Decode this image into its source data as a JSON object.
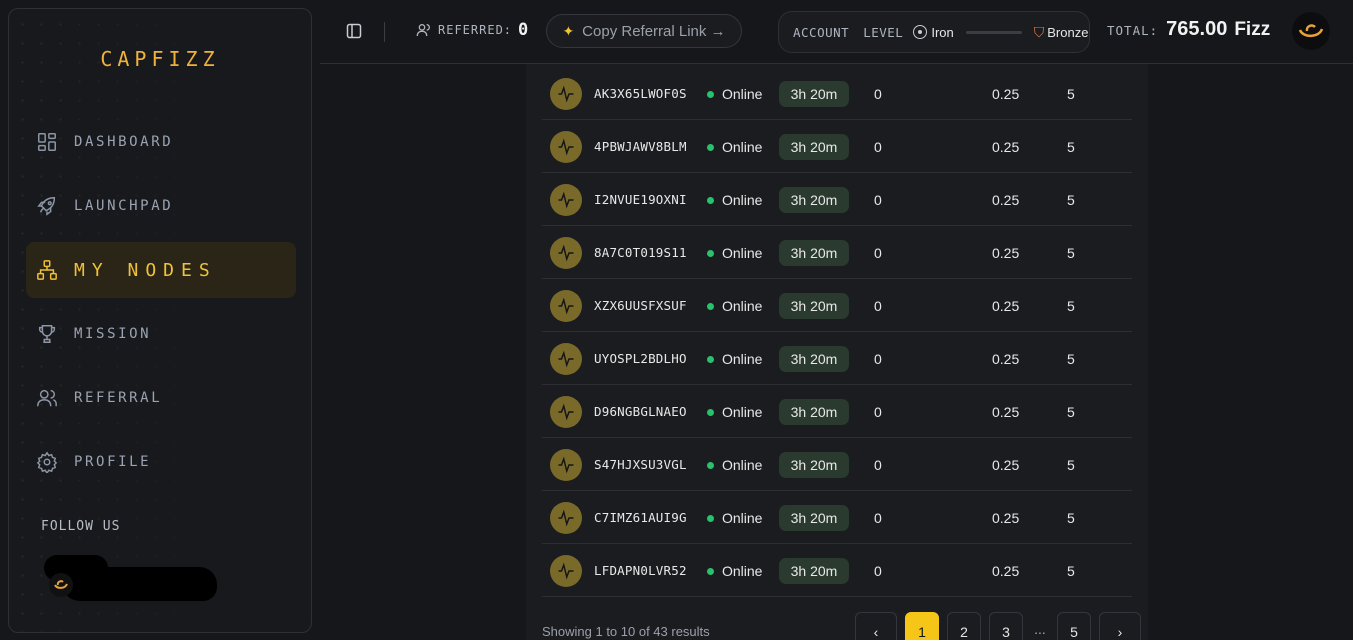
{
  "brand": "CAPFIZZ",
  "sidebar": {
    "items": [
      {
        "label": "DASHBOARD",
        "icon": "dashboard-icon"
      },
      {
        "label": "LAUNCHPAD",
        "icon": "rocket-icon"
      },
      {
        "label": "MY NODES",
        "icon": "network-icon",
        "active": true
      },
      {
        "label": "MISSION",
        "icon": "trophy-icon"
      },
      {
        "label": "REFERRAL",
        "icon": "users-icon"
      },
      {
        "label": "PROFILE",
        "icon": "gear-icon"
      }
    ],
    "follow_label": "FOLLOW US"
  },
  "topbar": {
    "referred_label": "REFERRED:",
    "referred_value": "0",
    "copy_label": "Copy Referral Link →",
    "account_label": "ACCOUNT",
    "level_label": "LEVEL",
    "current_level": "Iron",
    "next_level": "Bronze",
    "total_label": "TOTAL:",
    "total_value": "765.00",
    "total_unit": "Fizz"
  },
  "nodes": [
    {
      "id": "AK3X65LWOF0S",
      "status": "Online",
      "uptime": "3h 20m",
      "c1": "0",
      "c2": "0.25",
      "c3": "5"
    },
    {
      "id": "4PBWJAWV8BLM",
      "status": "Online",
      "uptime": "3h 20m",
      "c1": "0",
      "c2": "0.25",
      "c3": "5"
    },
    {
      "id": "I2NVUE19OXNI",
      "status": "Online",
      "uptime": "3h 20m",
      "c1": "0",
      "c2": "0.25",
      "c3": "5"
    },
    {
      "id": "8A7C0T019S11",
      "status": "Online",
      "uptime": "3h 20m",
      "c1": "0",
      "c2": "0.25",
      "c3": "5"
    },
    {
      "id": "XZX6UUSFXSUF",
      "status": "Online",
      "uptime": "3h 20m",
      "c1": "0",
      "c2": "0.25",
      "c3": "5"
    },
    {
      "id": "UYOSPL2BDLHO",
      "status": "Online",
      "uptime": "3h 20m",
      "c1": "0",
      "c2": "0.25",
      "c3": "5"
    },
    {
      "id": "D96NGBGLNAEO",
      "status": "Online",
      "uptime": "3h 20m",
      "c1": "0",
      "c2": "0.25",
      "c3": "5"
    },
    {
      "id": "S47HJXSU3VGL",
      "status": "Online",
      "uptime": "3h 20m",
      "c1": "0",
      "c2": "0.25",
      "c3": "5"
    },
    {
      "id": "C7IMZ61AUI9G",
      "status": "Online",
      "uptime": "3h 20m",
      "c1": "0",
      "c2": "0.25",
      "c3": "5"
    },
    {
      "id": "LFDAPN0LVR52",
      "status": "Online",
      "uptime": "3h 20m",
      "c1": "0",
      "c2": "0.25",
      "c3": "5"
    }
  ],
  "pagination": {
    "summary": "Showing 1 to 10 of 43 results",
    "prev": "‹",
    "pages": [
      "1",
      "2",
      "3"
    ],
    "ellipsis": "...",
    "last": "5",
    "next": "›",
    "current": "1"
  },
  "colors": {
    "accent": "#f0c23a",
    "online": "#27c26b",
    "page_active": "#f5c518"
  }
}
